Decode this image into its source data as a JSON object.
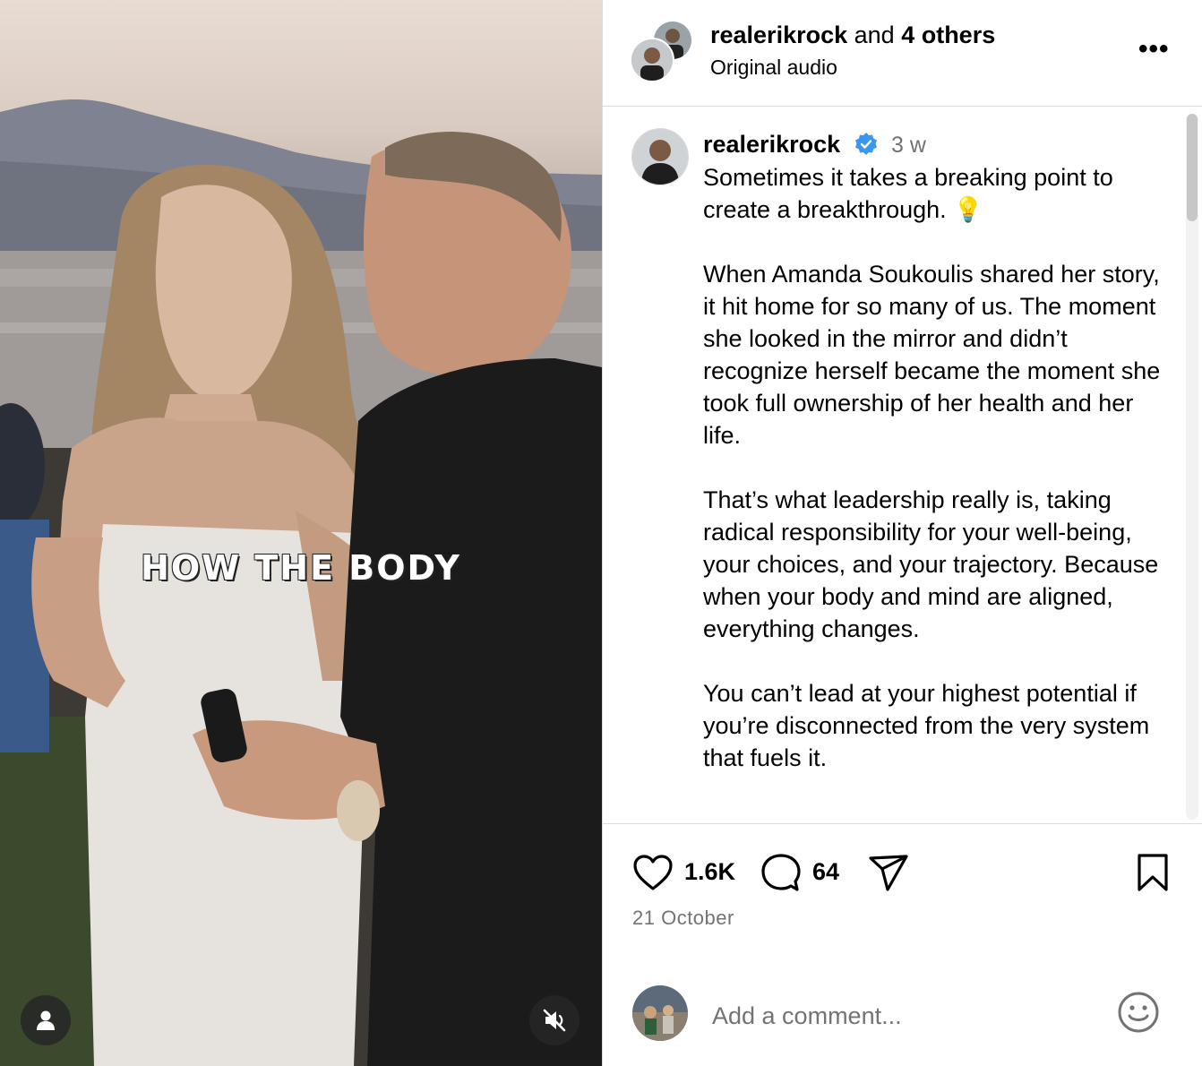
{
  "video": {
    "caption": "HOW THE BODY",
    "user_icon": "user-icon",
    "mute_icon": "muted-speaker-icon"
  },
  "header": {
    "username": "realerikrock",
    "and_text": " and ",
    "others": "4 others",
    "audio": "Original audio",
    "more_icon": "more-icon",
    "more_glyph": "•••"
  },
  "post": {
    "username": "realerikrock",
    "time": "3 w",
    "paragraphs": [
      "Sometimes it takes a breaking point to create a breakthrough. 💡",
      "When Amanda Soukoulis shared her story, it hit home for so many of us. The moment she looked in the mirror and didn’t recognize herself became the moment she took full ownership of her health and her life.",
      "That’s what leadership really is, taking radical responsibility for your well-being, your choices, and your trajectory. Because when your body and mind are aligned, everything changes.",
      "You can’t lead at your highest potential if you’re disconnected from the very system that fuels it."
    ]
  },
  "actions": {
    "likes": "1.6K",
    "comments": "64",
    "date": "21 October"
  },
  "comment": {
    "placeholder": "Add a comment..."
  },
  "colors": {
    "verified": "#3897f0",
    "muted_text": "#737373",
    "divider": "#dbdbdb"
  }
}
